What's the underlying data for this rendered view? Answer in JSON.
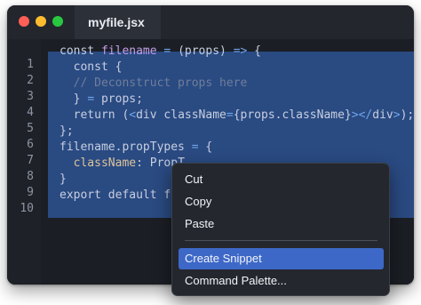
{
  "window": {
    "tab_title": "myfile.jsx"
  },
  "editor": {
    "line_numbers": [
      "1",
      "2",
      "3",
      "4",
      "5",
      "6",
      "7",
      "8",
      "9",
      "10"
    ],
    "lines": [
      [
        {
          "t": "const ",
          "c": "kw"
        },
        {
          "t": "filename",
          "c": "var"
        },
        {
          "t": " = ",
          "c": "op"
        },
        {
          "t": "(props) ",
          "c": "kw"
        },
        {
          "t": "=>",
          "c": "op"
        },
        {
          "t": " {",
          "c": "kw"
        }
      ],
      [
        {
          "t": "  const {",
          "c": "kw"
        }
      ],
      [
        {
          "t": "  // Deconstruct props here",
          "c": "cm"
        }
      ],
      [
        {
          "t": "  } ",
          "c": "kw"
        },
        {
          "t": "=",
          "c": "op"
        },
        {
          "t": " props;",
          "c": "kw"
        }
      ],
      [
        {
          "t": "  return (",
          "c": "kw"
        },
        {
          "t": "<",
          "c": "op"
        },
        {
          "t": "div ",
          "c": "kw"
        },
        {
          "t": "className",
          "c": "kw"
        },
        {
          "t": "=",
          "c": "op"
        },
        {
          "t": "{props.className}",
          "c": "kw"
        },
        {
          "t": "></",
          "c": "op"
        },
        {
          "t": "div",
          "c": "kw"
        },
        {
          "t": ">",
          "c": "op"
        },
        {
          "t": ");",
          "c": "kw"
        }
      ],
      [
        {
          "t": "};",
          "c": "kw"
        }
      ],
      [
        {
          "t": "filename.propTypes ",
          "c": "kw"
        },
        {
          "t": "=",
          "c": "op"
        },
        {
          "t": " {",
          "c": "kw"
        }
      ],
      [
        {
          "t": "  ",
          "c": "kw"
        },
        {
          "t": "className",
          "c": "at"
        },
        {
          "t": ": PropT",
          "c": "kw"
        }
      ],
      [
        {
          "t": "}",
          "c": "kw"
        }
      ],
      [
        {
          "t": "export default fi",
          "c": "kw"
        }
      ]
    ]
  },
  "context_menu": {
    "items": [
      "Cut",
      "Copy",
      "Paste",
      "Create Snippet",
      "Command Palette..."
    ],
    "active_item": "Create Snippet"
  }
}
